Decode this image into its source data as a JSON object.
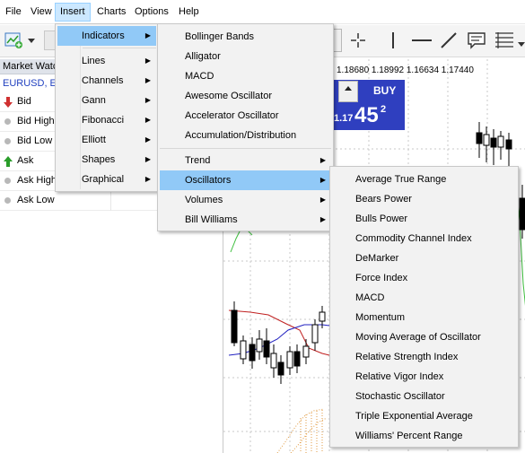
{
  "menubar": {
    "items": [
      {
        "label": "File"
      },
      {
        "label": "View"
      },
      {
        "label": "Insert"
      },
      {
        "label": "Charts"
      },
      {
        "label": "Options"
      },
      {
        "label": "Help"
      }
    ]
  },
  "toolbar": {
    "icons": [
      "new-chart-icon",
      "dropdown-arrow-icon",
      "crosshair-icon",
      "vertical-line-icon",
      "horizontal-line-icon",
      "trendline-icon",
      "text-icon",
      "fibonacci-icon"
    ]
  },
  "market_watch": {
    "header": "Market Watc",
    "symbol": "EURUSD, Eu",
    "rows": [
      {
        "label": "Bid",
        "icon": "down-arrow-icon"
      },
      {
        "label": "Bid High",
        "icon": "dot-icon"
      },
      {
        "label": "Bid Low",
        "icon": "dot-icon"
      },
      {
        "label": "Ask",
        "icon": "up-arrow-icon"
      },
      {
        "label": "Ask High",
        "icon": "dot-icon"
      },
      {
        "label": "Ask Low",
        "icon": "dot-icon"
      }
    ]
  },
  "chart": {
    "price_line": "1.18680 1.18992 1.16634 1.17440",
    "buy_label": "BUY",
    "price_small": "1.17",
    "price_big": "45",
    "price_sup": "2"
  },
  "insert_menu": {
    "items": [
      {
        "label": "Indicators",
        "submenu": true
      },
      {
        "label": "Lines",
        "submenu": true
      },
      {
        "label": "Channels",
        "submenu": true
      },
      {
        "label": "Gann",
        "submenu": true
      },
      {
        "label": "Fibonacci",
        "submenu": true
      },
      {
        "label": "Elliott",
        "submenu": true
      },
      {
        "label": "Shapes",
        "submenu": true
      },
      {
        "label": "Graphical",
        "submenu": true
      }
    ]
  },
  "indicators_menu": {
    "items": [
      {
        "label": "Bollinger Bands"
      },
      {
        "label": "Alligator"
      },
      {
        "label": "MACD"
      },
      {
        "label": "Awesome Oscillator"
      },
      {
        "label": "Accelerator Oscillator"
      },
      {
        "label": "Accumulation/Distribution"
      },
      {
        "label": "Trend",
        "submenu": true
      },
      {
        "label": "Oscillators",
        "submenu": true
      },
      {
        "label": "Volumes",
        "submenu": true
      },
      {
        "label": "Bill Williams",
        "submenu": true
      }
    ]
  },
  "oscillators_menu": {
    "items": [
      {
        "label": "Average True Range"
      },
      {
        "label": "Bears Power"
      },
      {
        "label": "Bulls Power"
      },
      {
        "label": "Commodity Channel Index"
      },
      {
        "label": "DeMarker"
      },
      {
        "label": "Force Index"
      },
      {
        "label": "MACD"
      },
      {
        "label": "Momentum"
      },
      {
        "label": "Moving Average of Oscillator"
      },
      {
        "label": "Relative Strength Index"
      },
      {
        "label": "Relative Vigor Index"
      },
      {
        "label": "Stochastic Oscillator"
      },
      {
        "label": "Triple Exponential Average"
      },
      {
        "label": "Williams' Percent Range"
      }
    ]
  },
  "colors": {
    "menu_highlight": "#91c9f7",
    "buy_panel": "#2f3fbf",
    "symbol_text": "#1f3fbf",
    "bid_arrow": "#d03030",
    "ask_arrow": "#2a9d2a"
  }
}
